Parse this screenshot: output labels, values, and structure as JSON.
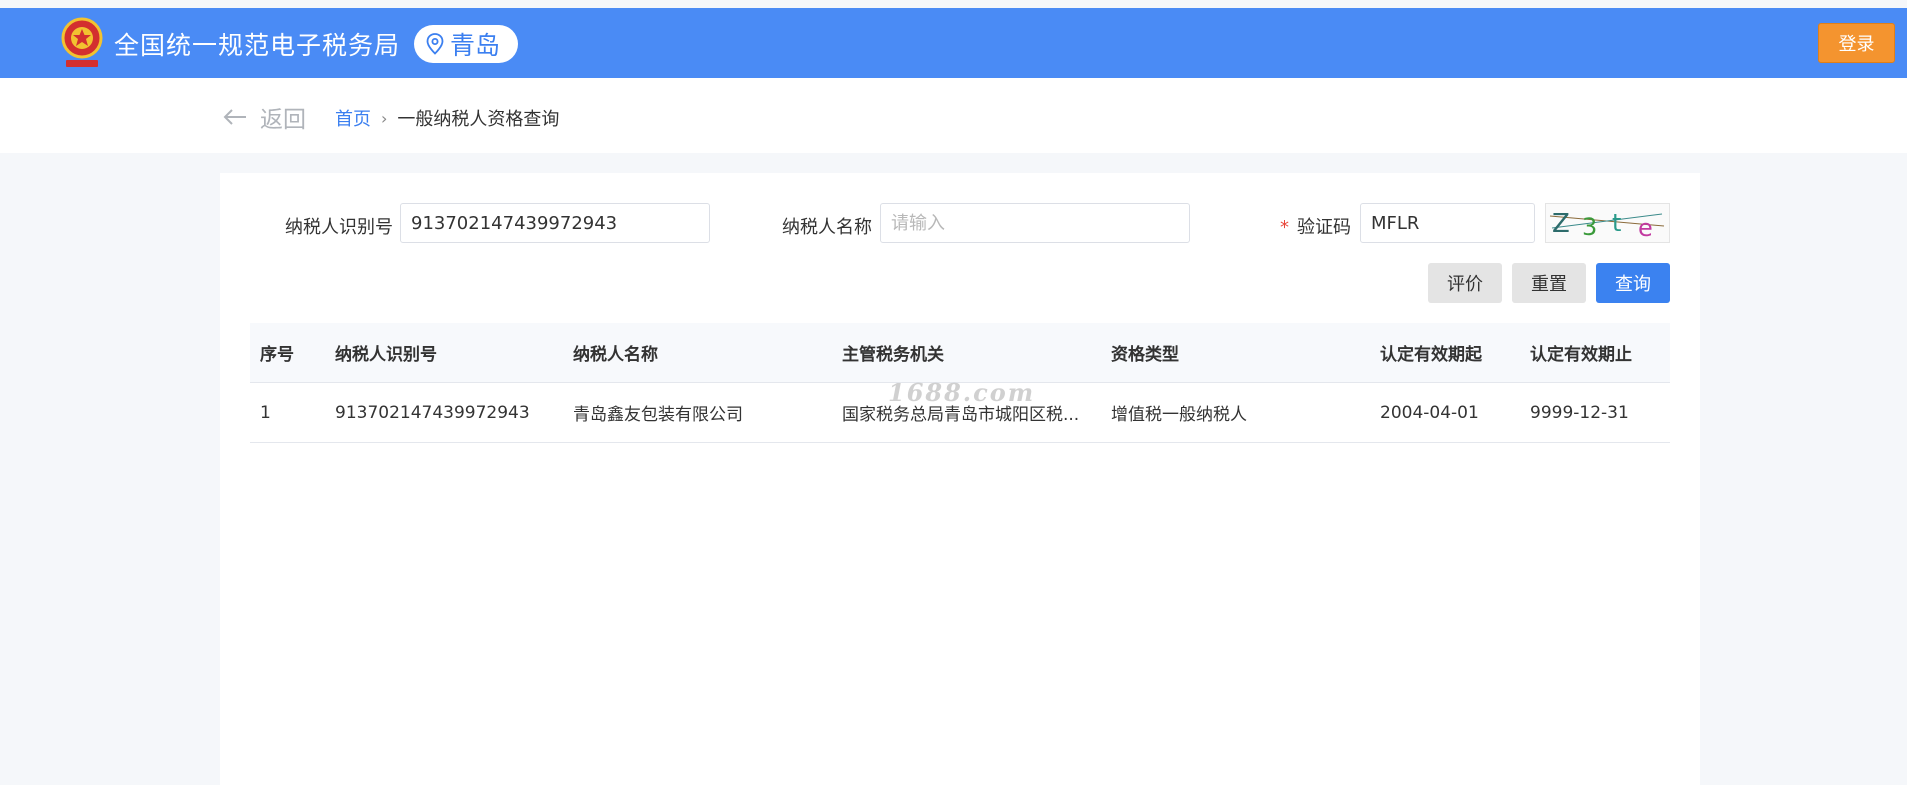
{
  "header": {
    "site_title": "全国统一规范电子税务局",
    "region": "青岛",
    "login_label": "登录"
  },
  "nav": {
    "back_label": "返回",
    "breadcrumb_home": "首页",
    "breadcrumb_sep": "›",
    "breadcrumb_current": "一般纳税人资格查询"
  },
  "form": {
    "taxpayer_id_label": "纳税人识别号",
    "taxpayer_id_value": "913702147439972943",
    "taxpayer_name_label": "纳税人名称",
    "taxpayer_name_placeholder": "请输入",
    "captcha_required_mark": "*",
    "captcha_label": "验证码",
    "captcha_value": "MFLR",
    "captcha_image_text": "Z3te"
  },
  "actions": {
    "evaluate_label": "评价",
    "reset_label": "重置",
    "query_label": "查询"
  },
  "table": {
    "headers": [
      "序号",
      "纳税人识别号",
      "纳税人名称",
      "主管税务机关",
      "资格类型",
      "认定有效期起",
      "认定有效期止"
    ],
    "rows": [
      [
        "1",
        "913702147439972943",
        "青岛鑫友包装有限公司",
        "国家税务总局青岛市城阳区税...",
        "增值税一般纳税人",
        "2004-04-01",
        "9999-12-31"
      ]
    ]
  },
  "watermark": "1688.com",
  "colors": {
    "header_blue": "#4a8bf5",
    "login_orange": "#f4942f",
    "primary_blue": "#3b82f0",
    "link_blue": "#3b7ff0"
  }
}
